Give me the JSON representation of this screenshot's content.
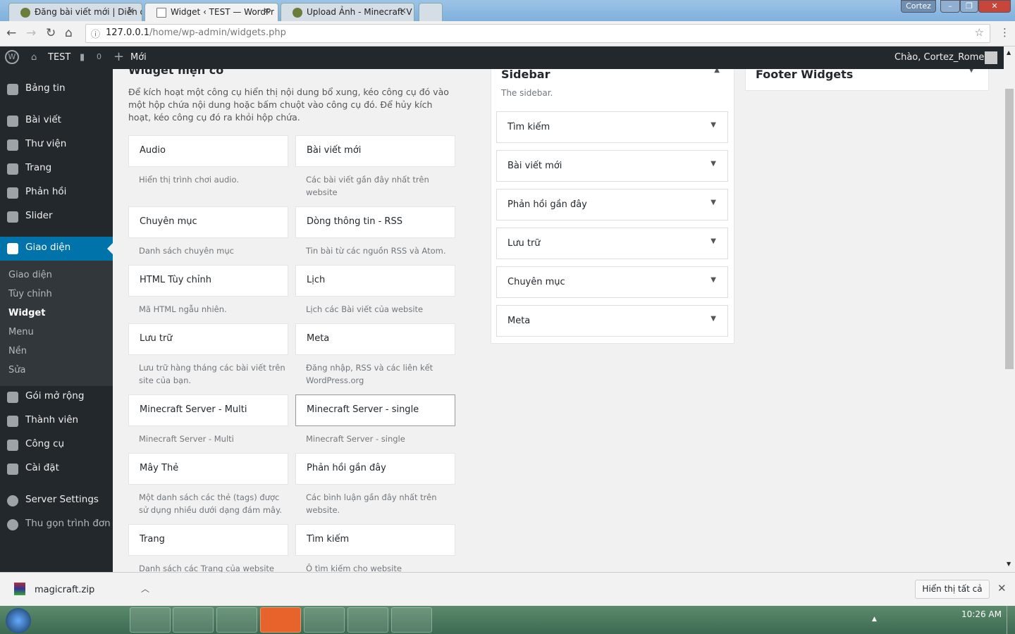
{
  "browser": {
    "tabs": [
      {
        "title": "Đăng bài viết mới | Diễn đ"
      },
      {
        "title": "Widget ‹ TEST — WordPr"
      },
      {
        "title": "Upload Ảnh - Minecraft V"
      }
    ],
    "user_badge": "Cortez",
    "url_host": "127.0.0.1",
    "url_path": "/home/wp-admin/widgets.php"
  },
  "adminbar": {
    "site": "TEST",
    "comments": "0",
    "new": "Mới",
    "greeting": "Chào, Cortez_Romeo"
  },
  "menu": {
    "items": [
      "Bảng tin",
      "Bài viết",
      "Thư viện",
      "Trang",
      "Phản hồi",
      "Slider",
      "Giao diện",
      "Gói mở rộng",
      "Thành viên",
      "Công cụ",
      "Cài đặt",
      "Server Settings",
      "Thu gọn trình đơn"
    ],
    "submenu": [
      "Giao diện",
      "Tùy chỉnh",
      "Widget",
      "Menu",
      "Nền",
      "Sửa"
    ]
  },
  "available": {
    "title": "Widget hiện có",
    "intro": "Để kích hoạt một công cụ hiển thị nội dung bổ xung, kéo công cụ đó vào một hộp chứa nội dung hoặc bấm chuột vào công cụ đó. Để hủy kích hoạt, kéo công cụ đó ra khỏi hộp chứa.",
    "widgets": [
      {
        "name": "Audio",
        "desc": "Hiển thị trình chơi audio."
      },
      {
        "name": "Bài viết mới",
        "desc": "Các bài viết gần đây nhất trên website"
      },
      {
        "name": "Chuyên mục",
        "desc": "Danh sách chuyên mục"
      },
      {
        "name": "Dòng thông tin - RSS",
        "desc": "Tin bài từ các nguồn RSS và Atom."
      },
      {
        "name": "HTML Tùy chỉnh",
        "desc": "Mã HTML ngẫu nhiên."
      },
      {
        "name": "Lịch",
        "desc": "Lịch các Bài viết của website"
      },
      {
        "name": "Lưu trữ",
        "desc": "Lưu trữ hàng tháng các bài viết trên site của bạn."
      },
      {
        "name": "Meta",
        "desc": "Đăng nhập, RSS và các liên kết WordPress.org"
      },
      {
        "name": "Minecraft Server - Multi",
        "desc": "Minecraft Server - Multi"
      },
      {
        "name": "Minecraft Server - single",
        "desc": "Minecraft Server - single"
      },
      {
        "name": "Mây Thẻ",
        "desc": "Một danh sách các thẻ (tags) được sử dụng nhiều dưới dạng đám mây."
      },
      {
        "name": "Phản hồi gần đây",
        "desc": "Các bình luận gần đây nhất trên website."
      },
      {
        "name": "Trang",
        "desc": "Danh sách các Trang của website"
      },
      {
        "name": "Tìm kiếm",
        "desc": "Ô tìm kiếm cho website"
      }
    ]
  },
  "sidebar": {
    "title": "Sidebar",
    "desc": "The sidebar.",
    "items": [
      "Tìm kiếm",
      "Bài viết mới",
      "Phản hồi gần đây",
      "Lưu trữ",
      "Chuyên mục",
      "Meta"
    ]
  },
  "footer": {
    "title": "Footer Widgets"
  },
  "download": {
    "file": "magicraft.zip",
    "show_all": "Hiển thị tất cả"
  },
  "taskbar": {
    "time": "10:26 AM"
  }
}
